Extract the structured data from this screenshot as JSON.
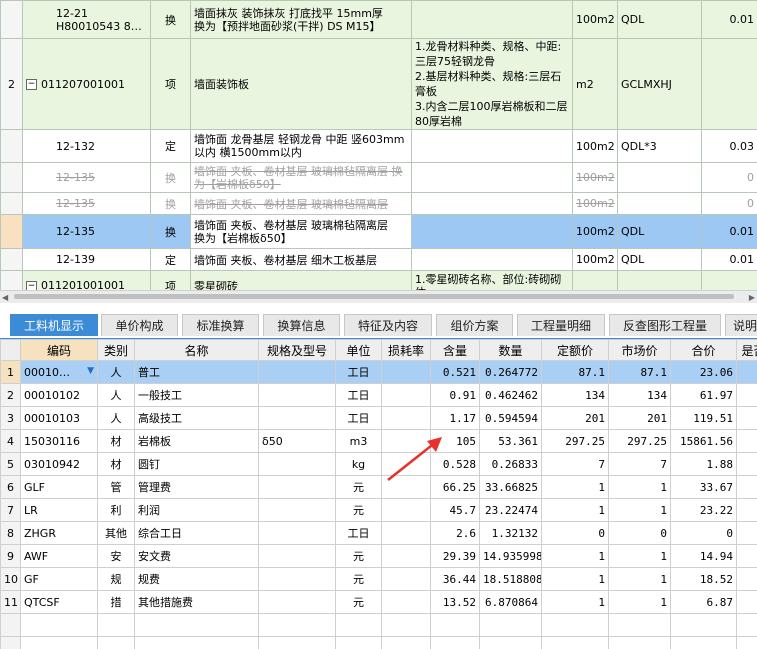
{
  "upper_rows": [
    {
      "seq": "",
      "code": "12-21\nH80010543 8…",
      "type": "换",
      "name": "墙面抹灰 装饰抹灰 打底找平 15mm厚\n换为【预拌地面砂浆(干拌) DS M15】",
      "feature": "",
      "unit": "100m2",
      "expr": "QDL",
      "qty": "0.01"
    },
    {
      "seq": "2",
      "code": "011207001001",
      "type": "项",
      "name": "墙面装饰板",
      "feature": "1.龙骨材料种类、规格、中距:三层75轻钢龙骨\n2.基层材料种类、规格:三层石膏板\n3.内含二层100厚岩棉板和二层80厚岩棉",
      "unit": "m2",
      "expr": "GCLMXHJ",
      "qty": ""
    },
    {
      "seq": "",
      "code": "12-132",
      "type": "定",
      "name": "墙饰面 龙骨基层 轻钢龙骨 中距 竖603mm以内 横1500mm以内",
      "feature": "",
      "unit": "100m2",
      "expr": "QDL*3",
      "qty": "0.03"
    },
    {
      "seq": "",
      "code": "12-135",
      "type": "换",
      "name": "墙饰面 夹板、卷材基层 玻璃棉毡隔离层 换为【岩棉板δ50】",
      "feature": "",
      "unit": "100m2",
      "expr": "",
      "qty": "0"
    },
    {
      "seq": "",
      "code": "12-135",
      "type": "换",
      "name": "墙饰面 夹板、卷材基层 玻璃棉毡隔离层",
      "feature": "",
      "unit": "100m2",
      "expr": "",
      "qty": "0"
    },
    {
      "seq": "",
      "code": "12-135",
      "type": "换",
      "name": "墙饰面 夹板、卷材基层 玻璃棉毡隔离层\n换为【岩棉板δ50】",
      "feature": "",
      "unit": "100m2",
      "expr": "QDL",
      "qty": "0.01"
    },
    {
      "seq": "",
      "code": "12-139",
      "type": "定",
      "name": "墙饰面 夹板、卷材基层 细木工板基层",
      "feature": "",
      "unit": "100m2",
      "expr": "QDL",
      "qty": "0.01"
    },
    {
      "seq": "",
      "code": "011201001001",
      "type": "项",
      "name": "零星砌砖",
      "feature": "1.零星砌砖名称、部位:砖砌砌体",
      "unit": "",
      "expr": "",
      "qty": ""
    }
  ],
  "tabs": [
    "工料机显示",
    "单价构成",
    "标准换算",
    "换算信息",
    "特征及内容",
    "组价方案",
    "工程量明细",
    "反查图形工程量",
    "说明"
  ],
  "table_headers": [
    "编码",
    "类别",
    "名称",
    "规格及型号",
    "单位",
    "损耗率",
    "含量",
    "数量",
    "定额价",
    "市场价",
    "合价",
    "是否"
  ],
  "rows": [
    {
      "n": "1",
      "code": "00010…",
      "cat": "人",
      "name": "普工",
      "spec": "",
      "unit": "工日",
      "loss": "",
      "content": "0.521",
      "qty": "0.264772",
      "quota": "87.1",
      "market": "87.1",
      "total": "23.06"
    },
    {
      "n": "2",
      "code": "00010102",
      "cat": "人",
      "name": "一般技工",
      "spec": "",
      "unit": "工日",
      "loss": "",
      "content": "0.91",
      "qty": "0.462462",
      "quota": "134",
      "market": "134",
      "total": "61.97"
    },
    {
      "n": "3",
      "code": "00010103",
      "cat": "人",
      "name": "高级技工",
      "spec": "",
      "unit": "工日",
      "loss": "",
      "content": "1.17",
      "qty": "0.594594",
      "quota": "201",
      "market": "201",
      "total": "119.51"
    },
    {
      "n": "4",
      "code": "15030116",
      "cat": "材",
      "name": "岩棉板",
      "spec": "δ50",
      "unit": "m3",
      "loss": "",
      "content": "105",
      "qty": "53.361",
      "quota": "297.25",
      "market": "297.25",
      "total": "15861.56"
    },
    {
      "n": "5",
      "code": "03010942",
      "cat": "材",
      "name": "圆钉",
      "spec": "",
      "unit": "kg",
      "loss": "",
      "content": "0.528",
      "qty": "0.26833",
      "quota": "7",
      "market": "7",
      "total": "1.88"
    },
    {
      "n": "6",
      "code": "GLF",
      "cat": "管",
      "name": "管理费",
      "spec": "",
      "unit": "元",
      "loss": "",
      "content": "66.25",
      "qty": "33.66825",
      "quota": "1",
      "market": "1",
      "total": "33.67"
    },
    {
      "n": "7",
      "code": "LR",
      "cat": "利",
      "name": "利润",
      "spec": "",
      "unit": "元",
      "loss": "",
      "content": "45.7",
      "qty": "23.22474",
      "quota": "1",
      "market": "1",
      "total": "23.22"
    },
    {
      "n": "8",
      "code": "ZHGR",
      "cat": "其他",
      "name": "综合工日",
      "spec": "",
      "unit": "工日",
      "loss": "",
      "content": "2.6",
      "qty": "1.32132",
      "quota": "0",
      "market": "0",
      "total": "0"
    },
    {
      "n": "9",
      "code": "AWF",
      "cat": "安",
      "name": "安文费",
      "spec": "",
      "unit": "元",
      "loss": "",
      "content": "29.39",
      "qty": "14.935998",
      "quota": "1",
      "market": "1",
      "total": "14.94"
    },
    {
      "n": "10",
      "code": "GF",
      "cat": "规",
      "name": "规费",
      "spec": "",
      "unit": "元",
      "loss": "",
      "content": "36.44",
      "qty": "18.518808",
      "quota": "1",
      "market": "1",
      "total": "18.52"
    },
    {
      "n": "11",
      "code": "QTCSF",
      "cat": "措",
      "name": "其他措施费",
      "spec": "",
      "unit": "元",
      "loss": "",
      "content": "13.52",
      "qty": "6.870864",
      "quota": "1",
      "market": "1",
      "total": "6.87"
    }
  ],
  "colors": {
    "tab_active": "#3b8bd6",
    "selected_row": "#9cc8f3",
    "green_row": "#e9f5df",
    "arrow": "#e8312a"
  }
}
